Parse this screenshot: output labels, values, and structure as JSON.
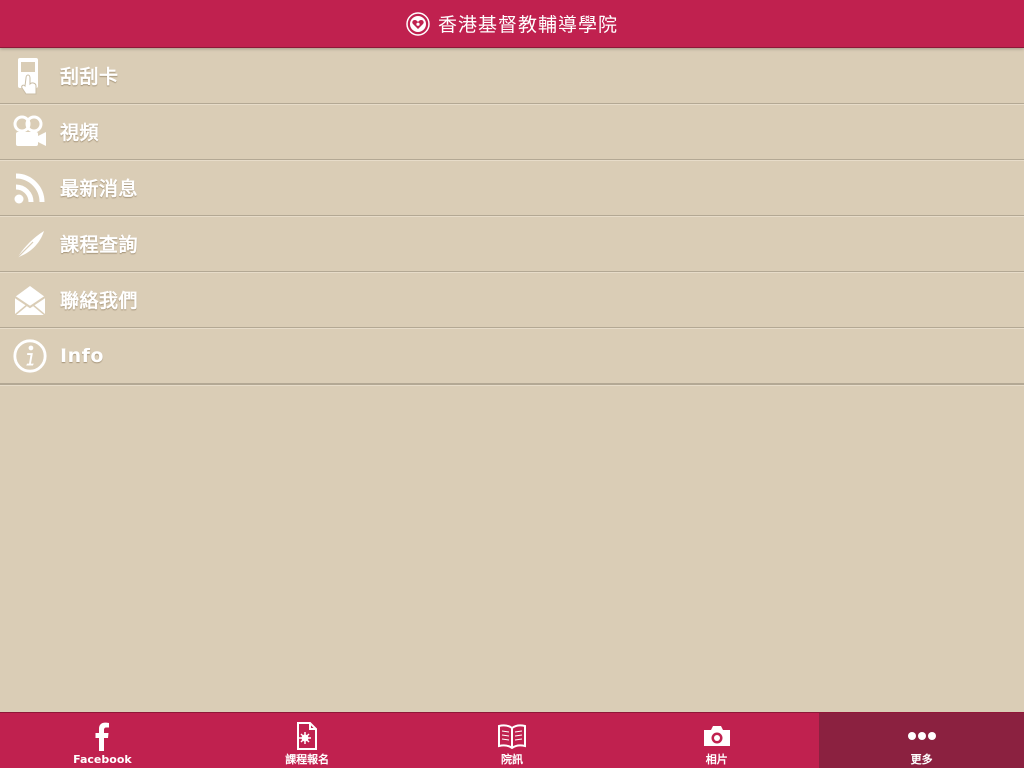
{
  "header": {
    "title": "香港基督教輔導學院",
    "logo_icon": "institute-heart-logo-icon"
  },
  "menu": {
    "items": [
      {
        "label": "刮刮卡",
        "icon": "scratch-card-icon"
      },
      {
        "label": "視頻",
        "icon": "video-camera-icon"
      },
      {
        "label": "最新消息",
        "icon": "rss-icon"
      },
      {
        "label": "課程查詢",
        "icon": "feather-icon"
      },
      {
        "label": "聯絡我們",
        "icon": "envelope-icon"
      },
      {
        "label": "Info",
        "icon": "info-icon"
      }
    ]
  },
  "tabbar": {
    "active_index": 4,
    "tabs": [
      {
        "label": "Facebook",
        "icon": "facebook-icon"
      },
      {
        "label": "課程報名",
        "icon": "document-icon"
      },
      {
        "label": "院訊",
        "icon": "book-icon"
      },
      {
        "label": "相片",
        "icon": "camera-icon"
      },
      {
        "label": "更多",
        "icon": "more-dots-icon"
      }
    ]
  },
  "colors": {
    "accent": "#c0214f",
    "accent_dark": "#8b2140",
    "background": "#dacdb6",
    "divider": "#b3a894",
    "text": "#ffffff"
  }
}
